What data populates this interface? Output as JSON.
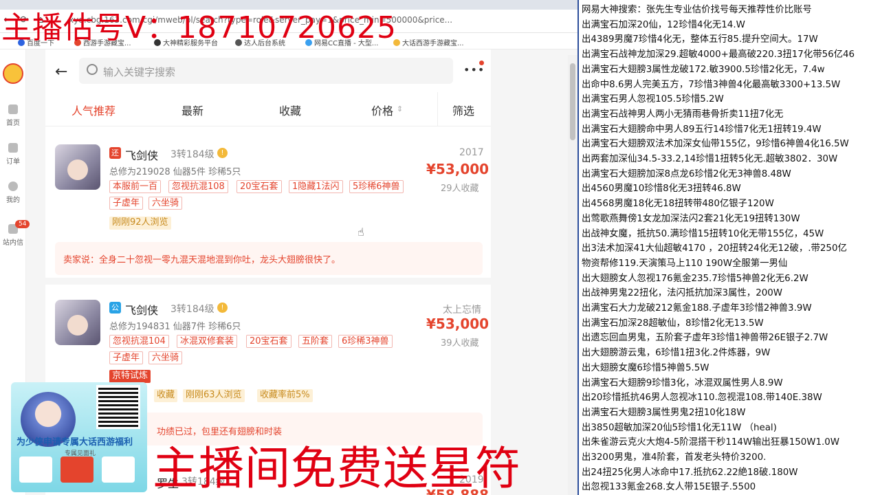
{
  "overlays": {
    "top_text": "主播估号V：18710720625",
    "bottom_text": "主播间免费送星符"
  },
  "browser": {
    "url": "xyq.cbg.163.com/cgi/mweb/pl/search?type=role&server_pay=1&price_min=500000&price...",
    "bookmarks": [
      "百度一下",
      "西游手游藏宝...",
      "大神精彩服务平台",
      "达人后台系统",
      "网易CC直播 - 大型...",
      "大话西游手游藏宝..."
    ]
  },
  "app": {
    "search_placeholder": "输入关键字搜索",
    "nav": [
      {
        "label": "首页"
      },
      {
        "label": "订单"
      },
      {
        "label": "我的"
      },
      {
        "label": "站内信",
        "badge": "54"
      }
    ],
    "filters": [
      "人气推荐",
      "最新",
      "收藏",
      "价格",
      "筛选"
    ],
    "cards": [
      {
        "server_tag": "还",
        "server_tag_color": "#e4442d",
        "name": "飞剑侠",
        "level": "3转184级",
        "meta": "总修为219028  仙器5件  珍稀5只",
        "year": "2017",
        "price": "¥53,000",
        "fav": "29人收藏",
        "chips": [
          "本服前一百",
          "忽视抗混108",
          "20宝石套",
          "1隐藏1法闪",
          "5珍稀6神兽",
          "子虚年",
          "六坐骑"
        ],
        "yellow_chips": [
          "刚刚92人浏览"
        ],
        "seller_note": "卖家说：全身二十忽视一零九混天混地混到你吐，龙头大翅膀很快了。"
      },
      {
        "server_tag": "公",
        "server_tag_color": "#29a3e6",
        "name": "飞剑侠",
        "level": "3转184级",
        "meta": "总修为194831  仙器7件  珍稀6只",
        "year": "太上忘情",
        "price": "¥53,000",
        "fav": "39人收藏",
        "chips": [
          "忽视抗混104",
          "冰混双修套装",
          "20宝石套",
          "五阶套",
          "6珍稀3神兽",
          "子虚年",
          "六坐骑"
        ],
        "yellow_chips": [
          "收藏",
          "刚刚63人浏览",
          "收藏率前5%"
        ],
        "seller_note": "功绩已过，包里还有翅膀和时装"
      },
      {
        "name": "罗生",
        "level": "3转184级",
        "year": "2019",
        "price": "¥58,888"
      }
    ],
    "partial_tag": "京特试炼"
  },
  "promo": {
    "title": "为少侠申请专属大话西游福利",
    "subtitle": "专属见面礼"
  },
  "right_panel": [
    "网易大神搜索：张先生专业估价找号每天推荐性价比账号",
    "出满宝石加深20仙，12珍惜4化无14.W",
    "出4389男魔7珍惜4化无，整体五行85.提升空间大。17W",
    "出满宝石战神龙加深29.超敏4000+最高破220.3扭17化带56亿46",
    "出满宝石大翅膀3属性龙破172.敏3900.5珍惜2化无，7.4w",
    "出命中8.6男人完美五方，7珍惜3神兽4化最高敏3300+13.5W",
    "出满宝石男人忽视105.5珍惜5.2W",
    "出满宝石战神男人两小无猜雨巷骨折卖11扭7化无",
    "出满宝石大翅膀命中男人89五行14珍惜7化无1扭转19.4W",
    "出满宝石大翅膀双法术加深女仙带155亿，9珍惜6神兽4化16.5W",
    "出两套加深仙34.5-33.2,14珍惜1扭转5化无.超敏3802．30W",
    "出满宝石大翅膀加深8点龙6珍惜2化无3神兽8.48W",
    "出4560男魔10珍惜8化无3扭转46.8W",
    "出4568男魔18化无18扭转带480亿银子120W",
    "出莺歌燕舞傍1女龙加深法闪2套21化无19扭转130W",
    "出战神女魔，抵抗50.满珍惜15扭转10化无带155亿，45W",
    "出3法术加深41大仙超敏4170 ，20扭转24化无12破，.带250亿",
    "物资帮修119.天演策马上110 190W全服第一男仙",
    "出大翅膀女人忽视176氪金235.7珍惜5神兽2化无6.2W",
    "出战神男鬼22扭化，法闪抵抗加深3属性，200W",
    "出满宝石大力龙破212氪金188.子虚年3珍惜2神兽3.9W",
    "出满宝石加深28超敏仙，8珍惜2化无13.5W",
    "出遗忘回血男鬼，五阶套子虚年3珍惜1神兽带26E银子2.7W",
    "出大翅膀游云鬼，6珍惜1扭3化.2件炼器，9W",
    "出大翅膀女魔6珍惜5神兽5.5W",
    "出满宝石大翅膀9珍惜3化，冰混双属性男人8.9W",
    "出20珍惜抵抗46男人忽视冰110.忽视混108.带140E.38W",
    "出满宝石大翅膀3属性男鬼2扭10化18W",
    "出3850超敏加深20仙5珍惜1化无11W （heal)",
    "出朱雀游云克火大炮4-5阶混搭干秒114W输出狂暴150W1.0W",
    "出3200男鬼，准4阶套，首发老头特价3200.",
    "出24扭25化男人冰命中17.抵抗62.22絶18破.180W",
    "出忽视133氪金268.女人带15E银子.5500"
  ]
}
